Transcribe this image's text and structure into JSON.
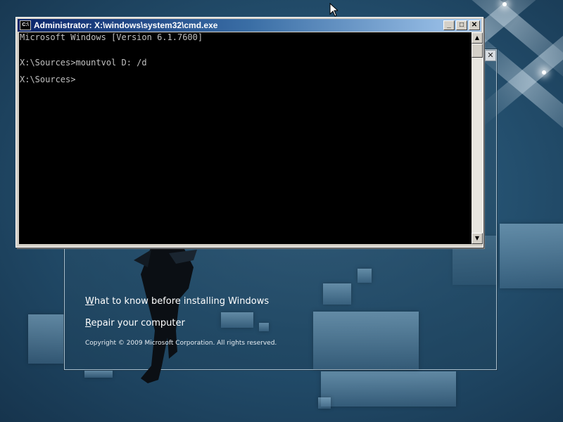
{
  "cmd_window": {
    "title": "Administrator: X:\\windows\\system32\\cmd.exe",
    "icon_label": "C:\\",
    "minimize_glyph": "_",
    "maximize_glyph": "□",
    "close_glyph": "✕",
    "console_lines": [
      "Microsoft Windows [Version 6.1.7600]",
      "",
      "X:\\Sources>mountvol D: /d",
      "",
      "X:\\Sources>"
    ],
    "scroll_up_glyph": "▲",
    "scroll_down_glyph": "▼"
  },
  "setup_window": {
    "close_glyph": "✕",
    "what_to_know_accel": "W",
    "what_to_know_rest": "hat to know before installing Windows",
    "repair_accel": "R",
    "repair_rest": "epair your computer",
    "copyright": "Copyright © 2009 Microsoft Corporation. All rights reserved."
  },
  "colors": {
    "desktop_bg": "#24506f",
    "titlebar_start": "#0a246a",
    "titlebar_end": "#a6caf0",
    "console_bg": "#000000",
    "console_fg": "#c0c0c0"
  },
  "icons": [
    "cmd-app-icon",
    "minimize-icon",
    "maximize-icon",
    "close-icon",
    "scroll-up-icon",
    "scroll-down-icon",
    "mouse-pointer-icon"
  ]
}
